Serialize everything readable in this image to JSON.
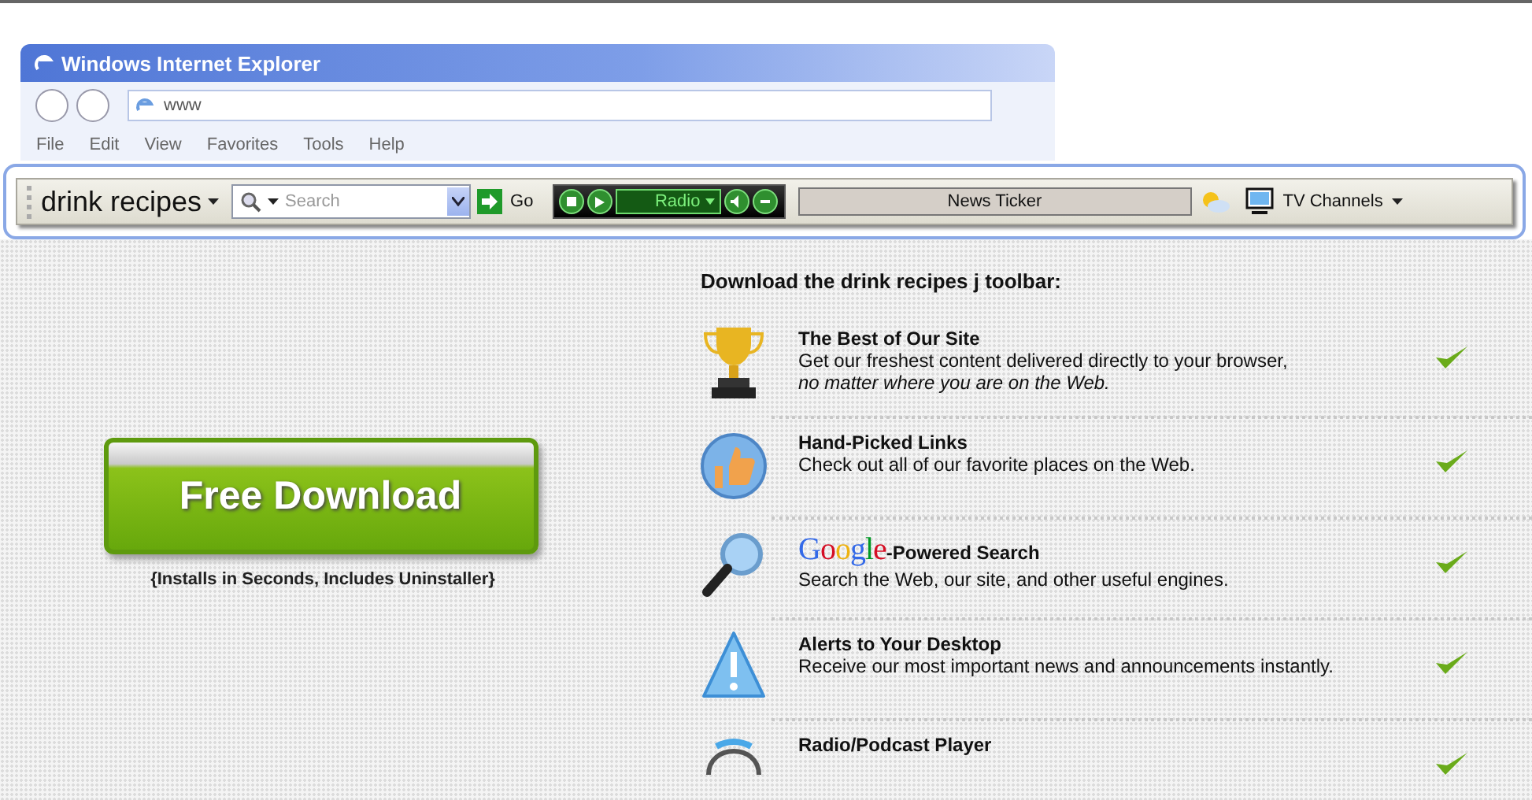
{
  "browser_window": {
    "title": "Windows Internet Explorer",
    "address": "www",
    "menu": [
      "File",
      "Edit",
      "View",
      "Favorites",
      "Tools",
      "Help"
    ]
  },
  "toolbar": {
    "brand": "drink recipes",
    "search": {
      "placeholder": "Search"
    },
    "go": "Go",
    "radio": {
      "station": "Radio"
    },
    "news_ticker": "News Ticker",
    "tv": "TV Channels"
  },
  "download": {
    "button": "Free Download",
    "note": "{Installs in Seconds, Includes Uninstaller}"
  },
  "features": {
    "heading": "Download the drink recipes j toolbar:",
    "items": [
      {
        "title": "The Best of Our Site",
        "description": "Get our freshest content delivered directly to your browser,",
        "note": "no matter where you are on the Web.",
        "checked": true
      },
      {
        "title": "Hand-Picked Links",
        "description": "Check out all of our favorite places on the Web.",
        "checked": true
      },
      {
        "logo": "Google",
        "title": "-Powered Search",
        "description": "Search the Web, our site, and other useful engines.",
        "checked": true
      },
      {
        "title": "Alerts to Your Desktop",
        "description": "Receive our most important news and announcements instantly.",
        "checked": true
      },
      {
        "title": "Radio/Podcast Player",
        "checked": true
      }
    ]
  }
}
